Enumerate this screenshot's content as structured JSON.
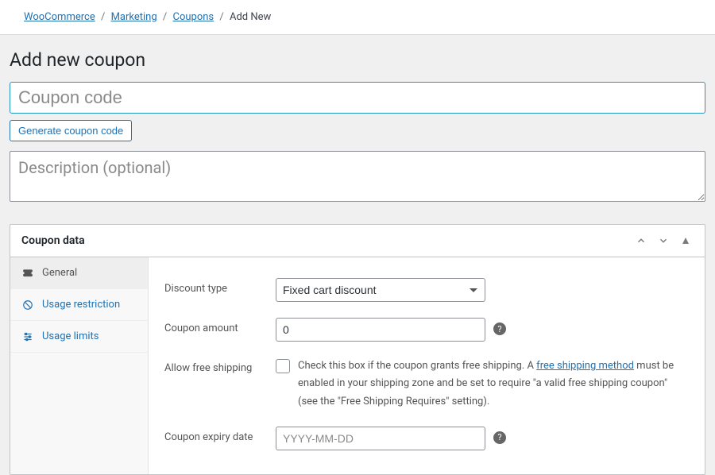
{
  "breadcrumb": {
    "items": [
      "WooCommerce",
      "Marketing",
      "Coupons"
    ],
    "sep": "/",
    "current": "Add New"
  },
  "page_title": "Add new coupon",
  "coupon_code": {
    "placeholder": "Coupon code",
    "value": ""
  },
  "generate_button": "Generate coupon code",
  "description": {
    "placeholder": "Description (optional)",
    "value": ""
  },
  "postbox": {
    "title": "Coupon data",
    "tabs": [
      {
        "icon": "ticket-icon",
        "label": "General",
        "active": true
      },
      {
        "icon": "no-entry-icon",
        "label": "Usage restriction",
        "active": false
      },
      {
        "icon": "sliders-icon",
        "label": "Usage limits",
        "active": false
      }
    ]
  },
  "fields": {
    "discount_type": {
      "label": "Discount type",
      "value": "Fixed cart discount"
    },
    "coupon_amount": {
      "label": "Coupon amount",
      "value": "0"
    },
    "allow_free_shipping": {
      "label": "Allow free shipping",
      "text_before": "Check this box if the coupon grants free shipping. A ",
      "link_text": "free shipping method",
      "text_after": " must be enabled in your shipping zone and be set to require \"a valid free shipping coupon\" (see the \"Free Shipping Requires\" setting)."
    },
    "expiry_date": {
      "label": "Coupon expiry date",
      "placeholder": "YYYY-MM-DD",
      "value": ""
    }
  },
  "help_icon_glyph": "?"
}
